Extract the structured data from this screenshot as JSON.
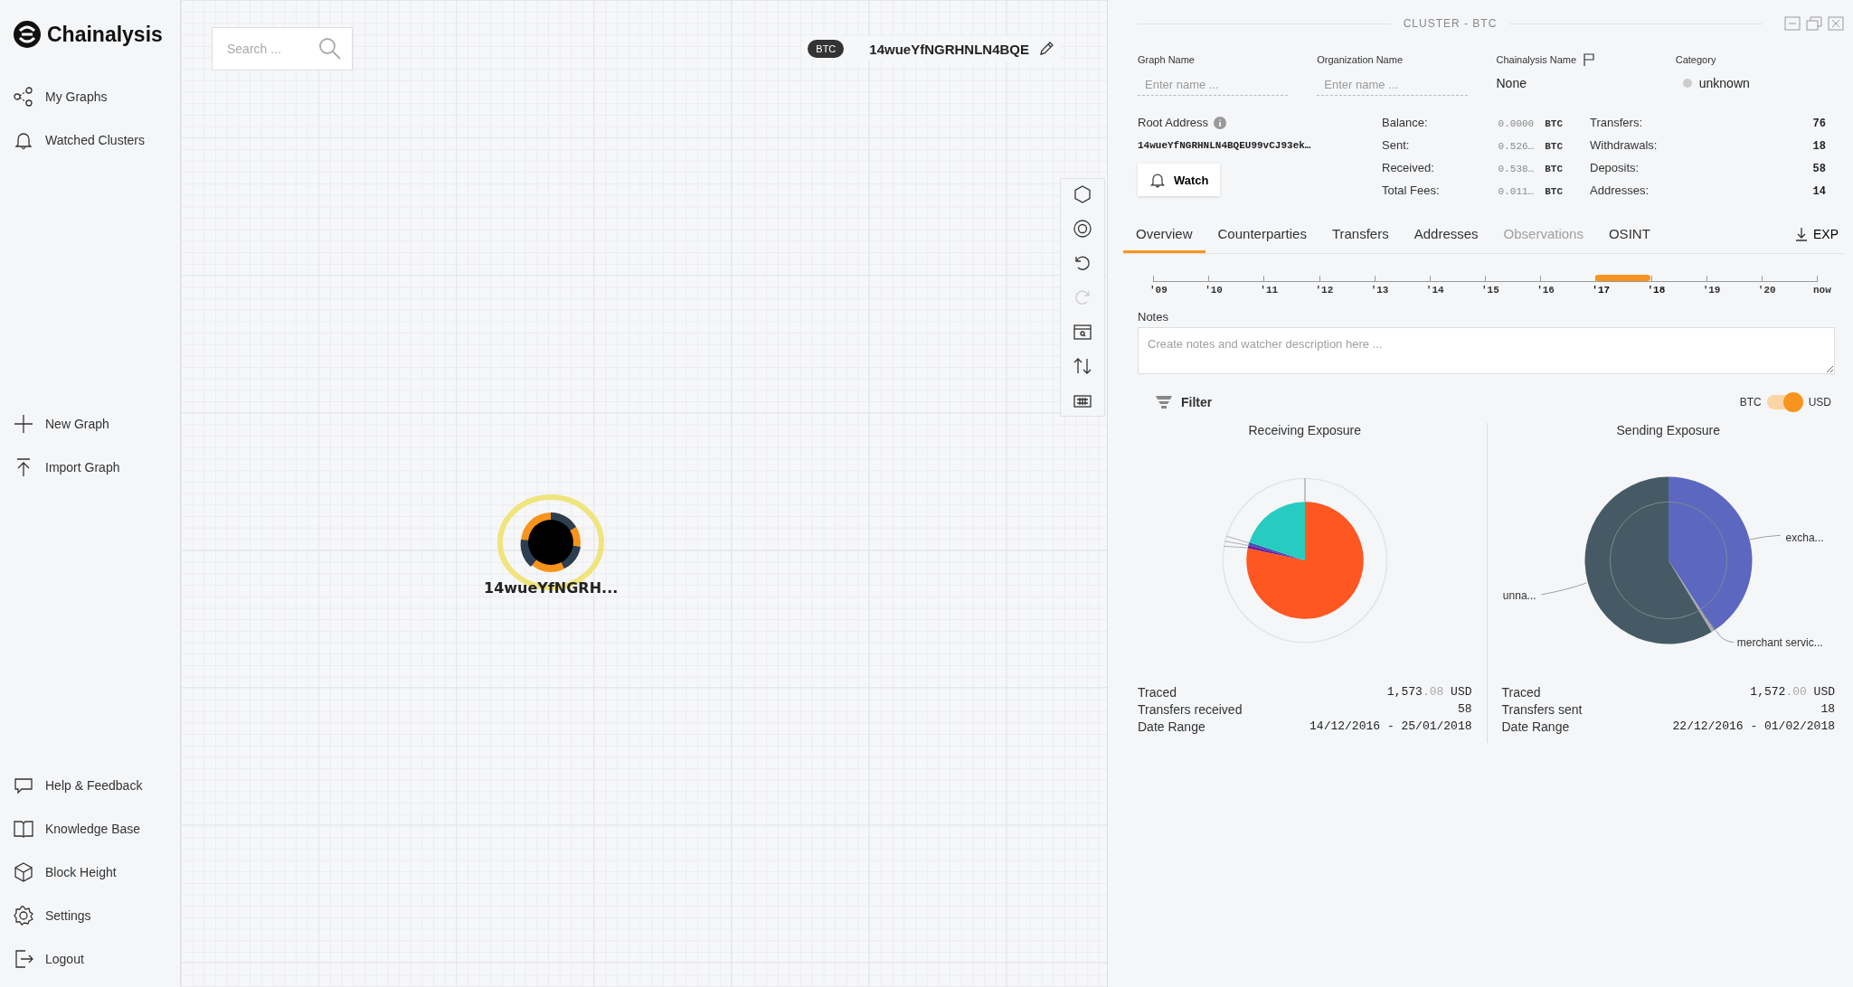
{
  "sidebar": {
    "logo": "Chainalysis",
    "top_items": [
      {
        "kind": "graphs",
        "label": "My Graphs"
      },
      {
        "kind": "bell",
        "label": "Watched Clusters"
      }
    ],
    "middle_items": [
      {
        "kind": "plus",
        "label": "New Graph"
      },
      {
        "kind": "upload",
        "label": "Import Graph"
      }
    ],
    "bottom_items": [
      {
        "kind": "chat",
        "label": "Help & Feedback"
      },
      {
        "kind": "book",
        "label": "Knowledge Base"
      },
      {
        "kind": "cube",
        "label": "Block Height"
      },
      {
        "kind": "gear",
        "label": "Settings"
      },
      {
        "kind": "logout",
        "label": "Logout"
      }
    ]
  },
  "canvas": {
    "search": {
      "placeholder": "Search ..."
    },
    "graph_header": {
      "badge": "BTC",
      "title": "14wueYfNGRHNLN4BQE"
    },
    "toolbar": [
      {
        "kind": "hexagon",
        "disabled": false
      },
      {
        "kind": "target",
        "disabled": false
      },
      {
        "kind": "undo",
        "disabled": false
      },
      {
        "kind": "redo",
        "disabled": true
      },
      {
        "kind": "calendar",
        "disabled": false
      },
      {
        "kind": "swap",
        "disabled": false
      },
      {
        "kind": "keyboard",
        "disabled": false
      }
    ],
    "node": {
      "label": "14wueYfNGRH...",
      "selected": true
    }
  },
  "panel": {
    "title": "CLUSTER - BTC",
    "fields": [
      {
        "kind": "input",
        "label": "Graph Name",
        "placeholder": "Enter name ..."
      },
      {
        "kind": "input",
        "label": "Organization Name",
        "placeholder": "Enter name ..."
      },
      {
        "kind": "flag",
        "label": "Chainalysis Name",
        "value": "None"
      },
      {
        "kind": "category",
        "label": "Category",
        "value": "unknown",
        "color": "#cccccc"
      }
    ],
    "root_address": {
      "label": "Root Address",
      "value": "14wueYfNGRHNLN4BQEU99vCJ93ek…"
    },
    "watch_button": "Watch",
    "balances": [
      {
        "label": "Balance:",
        "value": "0.0000",
        "unit": "BTC"
      },
      {
        "label": "Sent:",
        "value": "0.526…",
        "unit": "BTC"
      },
      {
        "label": "Received:",
        "value": "0.538…",
        "unit": "BTC"
      },
      {
        "label": "Total Fees:",
        "value": "0.011…",
        "unit": "BTC"
      }
    ],
    "counts": [
      {
        "label": "Transfers:",
        "value": "76"
      },
      {
        "label": "Withdrawals:",
        "value": "18"
      },
      {
        "label": "Deposits:",
        "value": "58"
      },
      {
        "label": "Addresses:",
        "value": "14"
      }
    ],
    "tabs": [
      {
        "label": "Overview",
        "selected": true,
        "disabled": false
      },
      {
        "label": "Counterparties",
        "selected": false,
        "disabled": false
      },
      {
        "label": "Transfers",
        "selected": false,
        "disabled": false
      },
      {
        "label": "Addresses",
        "selected": false,
        "disabled": false
      },
      {
        "label": "Observations",
        "selected": false,
        "disabled": true
      },
      {
        "label": "OSINT",
        "selected": false,
        "disabled": false
      }
    ],
    "export_button": "EXP",
    "timeline": [
      {
        "label": "'09",
        "highlighted": false
      },
      {
        "label": "'10",
        "highlighted": false
      },
      {
        "label": "'11",
        "highlighted": false
      },
      {
        "label": "'12",
        "highlighted": false
      },
      {
        "label": "'13",
        "highlighted": false
      },
      {
        "label": "'14",
        "highlighted": false
      },
      {
        "label": "'15",
        "highlighted": false
      },
      {
        "label": "'16",
        "highlighted": false
      },
      {
        "label": "'17",
        "highlighted": true
      },
      {
        "label": "'18",
        "highlighted": true
      },
      {
        "label": "'19",
        "highlighted": false
      },
      {
        "label": "'20",
        "highlighted": false
      },
      {
        "label": "now",
        "highlighted": false
      }
    ],
    "notes": {
      "label": "Notes",
      "placeholder": "Create notes and watcher description here ..."
    },
    "filter": "Filter",
    "currency_toggle": {
      "left": "BTC",
      "right": "USD",
      "on": true
    },
    "exposures": [
      {
        "kind": "receiving",
        "title": "Receiving Exposure",
        "stats": [
          {
            "label": "Traced",
            "whole": "1,573",
            "fraction": ".08",
            "unit": "USD"
          },
          {
            "label": "Transfers received",
            "whole": "58"
          },
          {
            "label": "Date Range",
            "whole": "14/12/2016 - 25/01/2018"
          }
        ]
      },
      {
        "kind": "sending",
        "title": "Sending Exposure",
        "labels": [
          "excha...",
          "unna...",
          "merchant servic..."
        ],
        "stats": [
          {
            "label": "Traced",
            "whole": "1,572",
            "fraction": ".00",
            "unit": "USD"
          },
          {
            "label": "Transfers sent",
            "whole": "18"
          },
          {
            "label": "Date Range",
            "whole": "22/12/2016 - 01/02/2018"
          }
        ]
      }
    ]
  }
}
